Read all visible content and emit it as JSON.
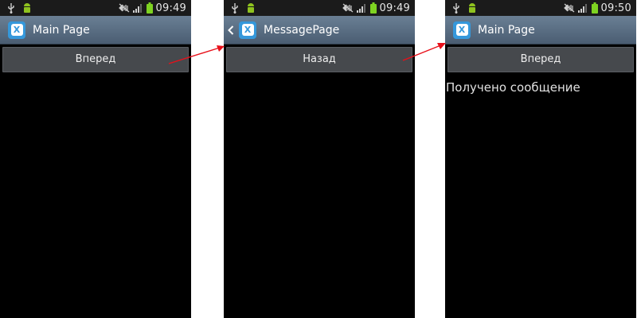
{
  "screens": [
    {
      "status": {
        "time": "09:49"
      },
      "title": "Main Page",
      "has_back": false,
      "button_label": "Вперед",
      "message": ""
    },
    {
      "status": {
        "time": "09:49"
      },
      "title": "MessagePage",
      "has_back": true,
      "button_label": "Назад",
      "message": ""
    },
    {
      "status": {
        "time": "09:50"
      },
      "title": "Main Page",
      "has_back": false,
      "button_label": "Вперед",
      "message": "Получено сообщение"
    }
  ],
  "icons": {
    "app": "xamarin-app-icon",
    "back": "back-chevron-icon",
    "status": [
      "usb-icon",
      "android-debug-icon",
      "silent-icon",
      "signal-icon",
      "battery-icon"
    ]
  },
  "colors": {
    "arrow": "#e8101a",
    "actionbar_top": "#6a7f94",
    "actionbar_bottom": "#4a5d72",
    "app_icon": "#3598db",
    "battery": "#7ed321",
    "android_debug": "#8fc31f"
  }
}
